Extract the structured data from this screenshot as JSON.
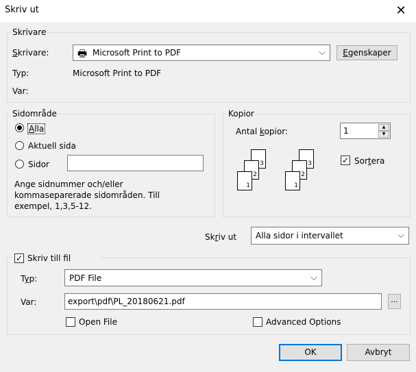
{
  "window": {
    "title": "Skriv ut",
    "close_glyph": "✕"
  },
  "printer_group": {
    "legend": "Skrivare",
    "printer_label": "Skrivare:",
    "printer_value": "Microsoft Print to PDF",
    "properties_button": "Egenskaper",
    "type_label": "Typ:",
    "type_value": "Microsoft Print to PDF",
    "where_label": "Var:",
    "where_value": ""
  },
  "range_group": {
    "legend": "Sidområde",
    "options": [
      "Alla",
      "Aktuell sida",
      "Sidor"
    ],
    "selected": "Alla",
    "pages_value": "",
    "hint": "Ange sidnummer och/eller kommaseparerade sidområden. Till exempel, 1,3,5-12."
  },
  "copies_group": {
    "legend": "Kopior",
    "count_label": "Antal kopior:",
    "count_value": "1",
    "collate_label": "Sortera",
    "collate_checked": true,
    "page_numbers": [
      "1",
      "2",
      "3"
    ]
  },
  "print_what": {
    "label": "Skriv ut",
    "value": "Alla sidor i intervallet"
  },
  "file_group": {
    "legend": "Skriv till fil",
    "checked": true,
    "type_label": "Typ:",
    "type_value": "PDF File",
    "where_label": "Var:",
    "path_value": "export\\pdf\\PL_20180621.pdf",
    "browse_label": "...",
    "open_file_label": "Open File",
    "open_file_checked": false,
    "advanced_label": "Advanced Options",
    "advanced_checked": false
  },
  "buttons": {
    "ok": "OK",
    "cancel": "Avbryt"
  },
  "icons": {
    "checkmark": "✓",
    "chevron": "⌵",
    "up": "▲",
    "down": "▼",
    "printer": "🖶"
  }
}
